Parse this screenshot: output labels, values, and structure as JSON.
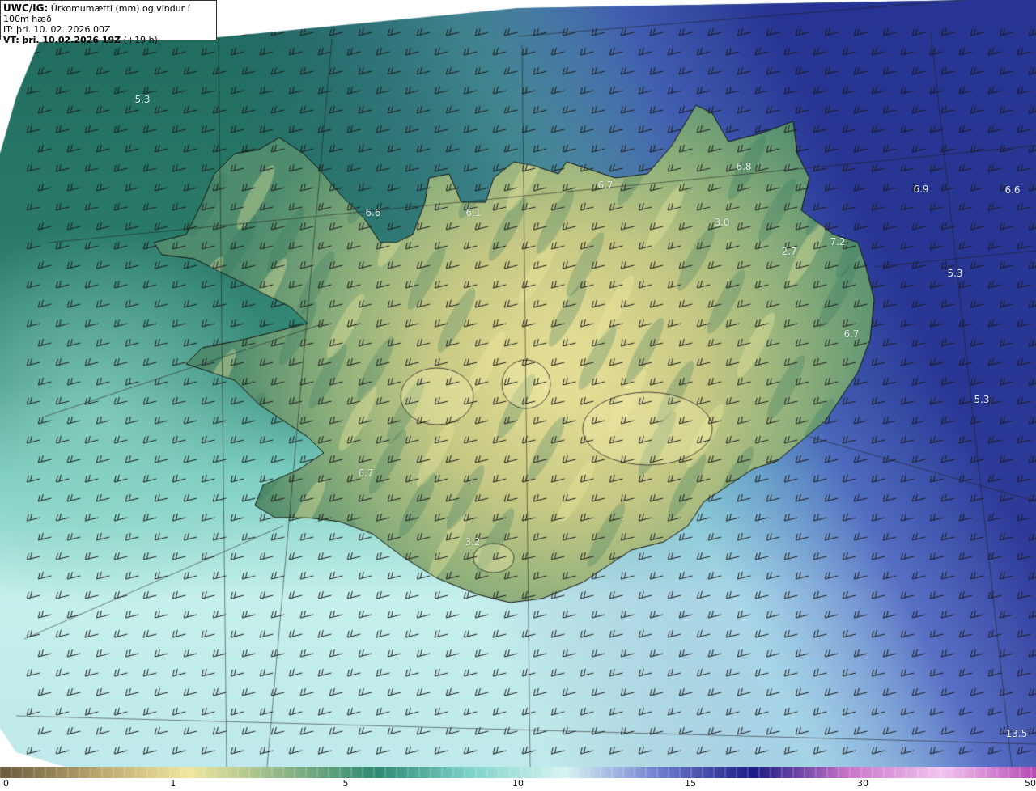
{
  "header": {
    "model": "UWC/IG:",
    "description": "Úrkomumætti (mm) og vindur í 100m hæð",
    "it_prefix": "IT:",
    "it_value": "þri. 10. 02. 2026 00Z",
    "vt_prefix": "VT:",
    "vt_value": "þri. 10.02.2026 19Z",
    "vt_lead": "(+19 h)"
  },
  "value_labels": [
    "5.3",
    "6.6",
    "6.1",
    "6.7",
    "6.8",
    "6.9",
    "6.6",
    "3.0",
    "2.7",
    "7.2",
    "5.3",
    "6.7",
    "5.3",
    "6.7",
    "3.2",
    "13.5"
  ],
  "colorbar": {
    "ticks": [
      "0",
      "1",
      "5",
      "10",
      "15",
      "30",
      "50"
    ],
    "stops": [
      "#6b5a3c",
      "#b7a46c",
      "#f2e6a0",
      "#8fb785",
      "#2f8a74",
      "#7fd3c8",
      "#d6f4f2",
      "#6f7fd0",
      "#1b1c86",
      "#c874c8",
      "#f3c6f0",
      "#b64bb4"
    ]
  },
  "colors": {
    "sea_deep": "#1f6e66",
    "land_high": "#e8e39a",
    "south_light": "#c8f1ee",
    "south_blue": "#3c49b0"
  }
}
